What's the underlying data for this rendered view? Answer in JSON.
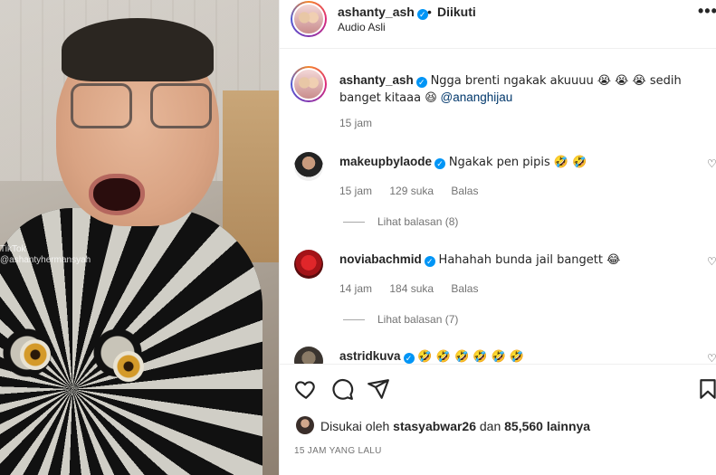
{
  "header": {
    "username": "ashanty_ash",
    "separator": "•",
    "follow_status": "Diikuti",
    "audio": "Audio Asli",
    "more_label": "•••"
  },
  "photo": {
    "watermark": "TikTok\n@ashantyhermansyah"
  },
  "caption": {
    "username": "ashanty_ash",
    "text": "Ngga brenti ngakak akuuuu 😭 😭 😭  sedih banget kitaaa 😆",
    "mention": "@ananghijau",
    "time": "15 jam"
  },
  "comments": [
    {
      "username": "makeupbylaode",
      "text": "Ngakak pen pipis 🤣 🤣",
      "time": "15 jam",
      "likes": "129 suka",
      "reply": "Balas",
      "view_replies": "Lihat balasan (8)"
    },
    {
      "username": "noviabachmid",
      "text": "Hahahah bunda jail bangett 😂",
      "time": "14 jam",
      "likes": "184 suka",
      "reply": "Balas",
      "view_replies": "Lihat balasan (7)"
    },
    {
      "username": "astridkuva",
      "text": "🤣 🤣 🤣 🤣 🤣 🤣"
    }
  ],
  "footer": {
    "liked_by_prefix": "Disukai oleh",
    "liked_by_user": "stasyabwar26",
    "liked_by_mid": "dan",
    "liked_by_count": "85,560 lainnya",
    "time_ago": "15 JAM YANG LALU"
  },
  "colors": {
    "verified": "#0095f6",
    "mention": "#00376b",
    "muted": "#737373"
  },
  "icons": [
    "heart-icon",
    "comment-icon",
    "share-icon",
    "bookmark-icon",
    "more-icon",
    "verified-icon"
  ]
}
